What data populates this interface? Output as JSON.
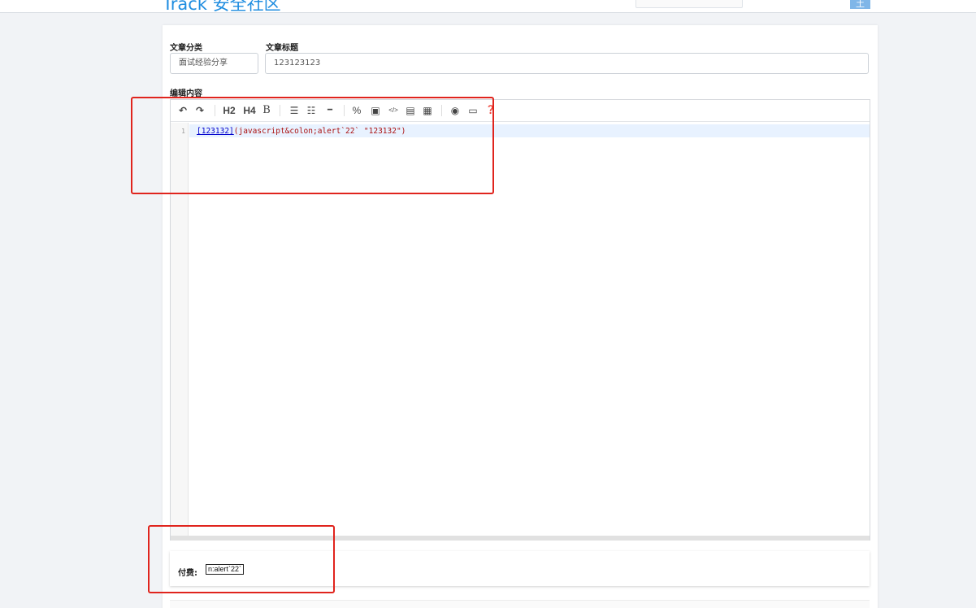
{
  "header": {
    "brand": "Track 安全社区",
    "avatar_char": "土"
  },
  "form": {
    "category_label": "文章分类",
    "category_value": "面试经验分享",
    "title_label": "文章标题",
    "title_value": "123123123",
    "content_label": "编辑内容"
  },
  "editor": {
    "toolbar": [
      {
        "name": "undo-icon",
        "glyph": "↶"
      },
      {
        "name": "redo-icon",
        "glyph": "↷"
      },
      {
        "name": "h2-button",
        "glyph": "H2"
      },
      {
        "name": "h4-button",
        "glyph": "H4"
      },
      {
        "name": "bold-button",
        "glyph": "B"
      },
      {
        "name": "unordered-list-icon",
        "glyph": "☰"
      },
      {
        "name": "ordered-list-icon",
        "glyph": "☷"
      },
      {
        "name": "hr-icon",
        "glyph": "━"
      },
      {
        "name": "link-icon",
        "glyph": "%"
      },
      {
        "name": "image-icon",
        "glyph": "▣"
      },
      {
        "name": "code-icon",
        "glyph": "</>"
      },
      {
        "name": "code-block-icon",
        "glyph": "▤"
      },
      {
        "name": "table-icon",
        "glyph": "▦"
      },
      {
        "name": "preview-icon",
        "glyph": "◉"
      },
      {
        "name": "fullscreen-icon",
        "glyph": "▭"
      },
      {
        "name": "help-icon",
        "glyph": "❓"
      }
    ],
    "line_number": "1",
    "code_link": "[123132]",
    "code_rest": "(javascript&colon;alert`22` \"123132\")"
  },
  "pay": {
    "label": "付费:",
    "link_text": "n:alert`22`"
  },
  "colors": {
    "brand": "#1f8de0",
    "highlight": "#e0241d"
  }
}
